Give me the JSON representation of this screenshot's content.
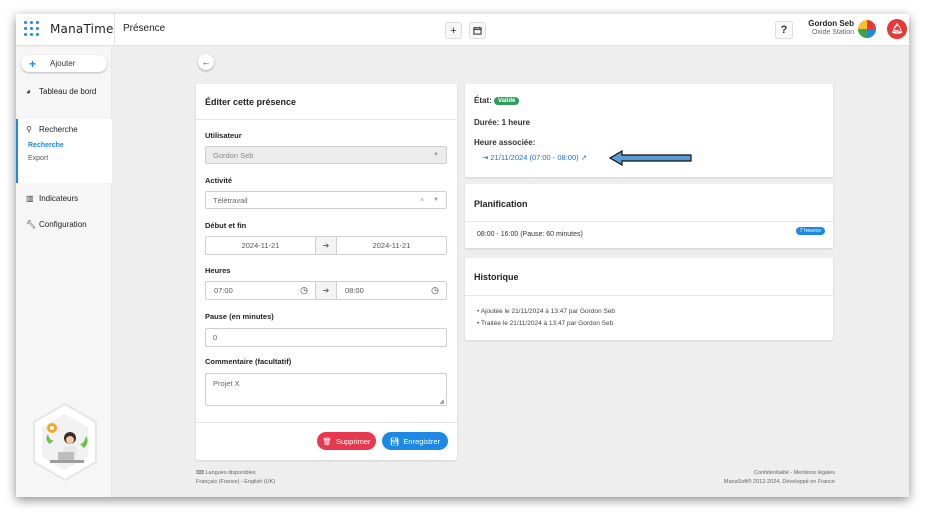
{
  "app": {
    "name": "ManaTime",
    "page_title": "Présence"
  },
  "topbar": {
    "add_icon": "plus-icon",
    "calendar_icon": "calendar-icon",
    "help_label": "?",
    "user_name": "Gordon Seb",
    "user_company": "Oxide Station"
  },
  "sidebar": {
    "add_label": "Ajouter",
    "dashboard": "Tableau de bord",
    "search": "Recherche",
    "search_sub": "Recherche",
    "export": "Export",
    "indicators": "Indicateurs",
    "configuration": "Configuration"
  },
  "form": {
    "title": "Éditer cette présence",
    "user_label": "Utilisateur",
    "user_value": "Gordon Seb",
    "activity_label": "Activité",
    "activity_value": "Télétravail",
    "dates_label": "Début et fin",
    "date_start": "2024-11-21",
    "date_end": "2024-11-21",
    "hours_label": "Heures",
    "hour_start": "07:00",
    "hour_end": "08:00",
    "pause_label": "Pause (en minutes)",
    "pause_value": "0",
    "comment_label": "Commentaire (facultatif)",
    "comment_value": "Projet X",
    "delete_label": "Supprimer",
    "save_label": "Enregistrer"
  },
  "status_card": {
    "state_label": "État:",
    "state_badge": "Validé",
    "duration": "Durée: 1 heure",
    "associated_label": "Heure associée:",
    "associated_link": "21/11/2024 (07:00 - 08:00)"
  },
  "planning_card": {
    "title": "Planification",
    "schedule": "08:00 - 16:00  (Pause: 60 minutes)",
    "hours_badge": "7 heures"
  },
  "history_card": {
    "title": "Historique",
    "entries": [
      "Ajoutée le 21/11/2024 à 13:47 par Gordon Seb",
      "Traitée le 21/11/2024 à 13:47 par Gordon Seb"
    ]
  },
  "footer": {
    "languages_title": "Langues disponibles",
    "languages": "Français (France) - English (UK)",
    "legal": "Confidentialité - Mentions légales",
    "copyright": "ManaSoft® 2012-2024, Développé en France"
  },
  "colors": {
    "primary": "#1e88e5",
    "danger": "#e53950",
    "success": "#2e9e5b",
    "annotation_arrow": "#5b9bd5"
  }
}
